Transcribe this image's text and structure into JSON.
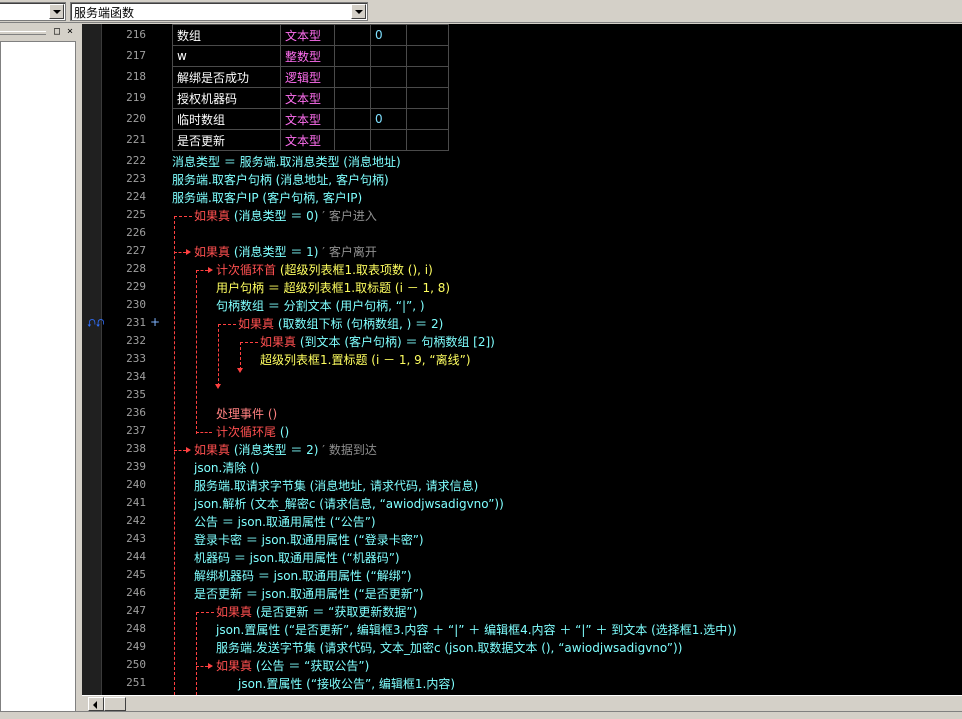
{
  "toolbar": {
    "combo1_value": "",
    "combo2_value": "服务端函数"
  },
  "left_panel": {
    "restore_glyph": "□",
    "close_glyph": "×"
  },
  "var_table": [
    {
      "ln": "216",
      "name": "数组",
      "type": "文本型",
      "f1": "",
      "f2": "0",
      "f3": ""
    },
    {
      "ln": "217",
      "name": "w",
      "type": "整数型",
      "f1": "",
      "f2": "",
      "f3": ""
    },
    {
      "ln": "218",
      "name": "解绑是否成功",
      "type": "逻辑型",
      "f1": "",
      "f2": "",
      "f3": ""
    },
    {
      "ln": "219",
      "name": "授权机器码",
      "type": "文本型",
      "f1": "",
      "f2": "",
      "f3": ""
    },
    {
      "ln": "220",
      "name": "临时数组",
      "type": "文本型",
      "f1": "",
      "f2": "0",
      "f3": ""
    },
    {
      "ln": "221",
      "name": "是否更新",
      "type": "文本型",
      "f1": "",
      "f2": "",
      "f3": ""
    }
  ],
  "code_lines": [
    {
      "ln": "222",
      "text": "消息类型 ＝ 服务端.取消息类型 (消息地址)"
    },
    {
      "ln": "223",
      "text": "服务端.取客户句柄 (消息地址, 客户句柄)"
    },
    {
      "ln": "224",
      "text": "服务端.取客户IP (客户句柄, 客户IP)"
    },
    {
      "ln": "225",
      "kw": "如果真",
      "rest": " (消息类型 ＝ 0)",
      "cm": " ′ 客户进入"
    },
    {
      "ln": "226",
      "text": ""
    },
    {
      "ln": "227",
      "kw": "如果真",
      "rest": " (消息类型 ＝ 1)",
      "cm": " ′ 客户离开"
    },
    {
      "ln": "228",
      "kw": "计次循环首",
      "rest": " (超级列表框1.取表项数 (), i)"
    },
    {
      "ln": "229",
      "text": "用户句柄 ＝ 超级列表框1.取标题 (i － 1, 8)"
    },
    {
      "ln": "230",
      "text": "句柄数组 ＝ 分割文本 (用户句柄, “|”, )"
    },
    {
      "ln": "231",
      "kw": "如果真",
      "rest": " (取数组下标 (句柄数组, ) ＝ 2)"
    },
    {
      "ln": "232",
      "kw": "如果真",
      "rest": " (到文本 (客户句柄) ＝ 句柄数组 [2])"
    },
    {
      "ln": "233",
      "text": "超级列表框1.置标题 (i － 1, 9, “离线”)"
    },
    {
      "ln": "234",
      "text": ""
    },
    {
      "ln": "235",
      "text": ""
    },
    {
      "ln": "236",
      "text": "处理事件 ()"
    },
    {
      "ln": "237",
      "kw": "计次循环尾",
      "rest": " ()"
    },
    {
      "ln": "238",
      "kw": "如果真",
      "rest": " (消息类型 ＝ 2)",
      "cm": " ′ 数据到达"
    },
    {
      "ln": "239",
      "text": "json.清除 ()"
    },
    {
      "ln": "240",
      "text": "服务端.取请求字节集 (消息地址, 请求代码, 请求信息)"
    },
    {
      "ln": "241",
      "text": "json.解析 (文本_解密c (请求信息, “awiodjwsadigvno”))"
    },
    {
      "ln": "242",
      "text": "公告 ＝ json.取通用属性 (“公告”)"
    },
    {
      "ln": "243",
      "text": "登录卡密 ＝ json.取通用属性 (“登录卡密”)"
    },
    {
      "ln": "244",
      "text": "机器码 ＝ json.取通用属性 (“机器码”)"
    },
    {
      "ln": "245",
      "text": "解绑机器码 ＝ json.取通用属性 (“解绑”)"
    },
    {
      "ln": "246",
      "text": "是否更新 ＝ json.取通用属性 (“是否更新”)"
    },
    {
      "ln": "247",
      "kw": "如果真",
      "rest": " (是否更新 ＝ “获取更新数据”)"
    },
    {
      "ln": "248",
      "text": "json.置属性 (“是否更新”, 编辑框3.内容 ＋ “|” ＋ 编辑框4.内容 ＋ “|” ＋ 到文本 (选择框1.选中))"
    },
    {
      "ln": "249",
      "text": "服务端.发送字节集 (请求代码, 文本_加密c (json.取数据文本 (), “awiodjwsadigvno”))"
    },
    {
      "ln": "250",
      "kw": "如果真",
      "rest": " (公告 ＝ “获取公告”)"
    },
    {
      "ln": "251",
      "text": "json.置属性 (“接收公告”, 编辑框1.内容)"
    }
  ]
}
